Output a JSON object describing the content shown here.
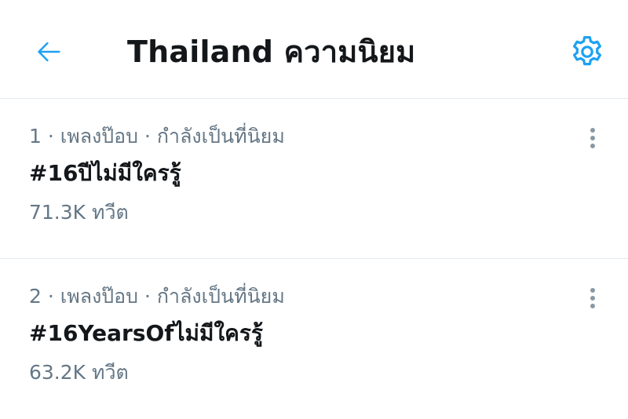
{
  "header": {
    "title": "Thailand ความนิยม",
    "back_icon": "arrow-left-icon",
    "settings_icon": "gear-icon",
    "accent_color": "#1da1f2"
  },
  "trends": [
    {
      "rank": "1",
      "category": "เพลงป๊อบ",
      "status": "กำลังเป็นที่นิยม",
      "meta": "1 · เพลงป๊อบ · กำลังเป็นที่นิยม",
      "hashtag": "#16ปีไม่มีใครรู้",
      "count": "71.3K ทวีต"
    },
    {
      "rank": "2",
      "category": "เพลงป๊อบ",
      "status": "กำลังเป็นที่นิยม",
      "meta": "2 · เพลงป๊อบ · กำลังเป็นที่นิยม",
      "hashtag": "#16YearsOfไม่มีใครรู้",
      "count": "63.2K ทวีต"
    }
  ],
  "colors": {
    "secondary_text": "#657786",
    "primary_text": "#14171a",
    "divider": "#e1e8ed",
    "more_icon": "#8899a6"
  }
}
